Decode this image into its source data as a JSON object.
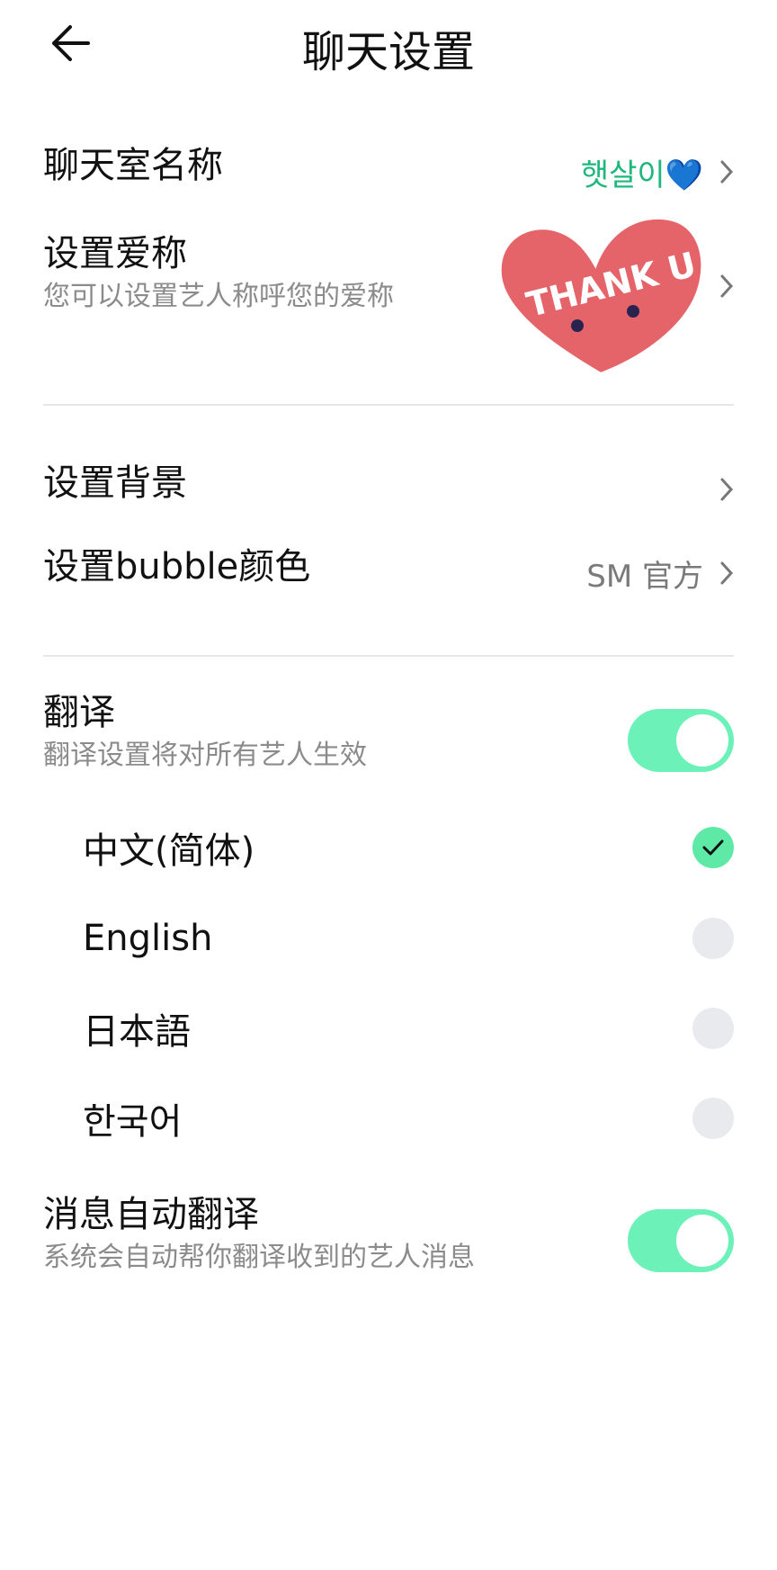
{
  "header": {
    "title": "聊天设置"
  },
  "room_name": {
    "label": "聊天室名称",
    "value": "햇살이💙"
  },
  "nickname": {
    "label": "设置爱称",
    "description": "您可以设置艺人称呼您的爱称",
    "sticker_text": "THANK U"
  },
  "background": {
    "label": "设置背景"
  },
  "bubble": {
    "label": "设置bubble颜色",
    "value": "SM 官方"
  },
  "translation": {
    "label": "翻译",
    "description": "翻译设置将对所有艺人生效",
    "enabled": true,
    "languages": [
      {
        "name": "中文(简体)",
        "selected": true
      },
      {
        "name": "English",
        "selected": false
      },
      {
        "name": "日本語",
        "selected": false
      },
      {
        "name": "한국어",
        "selected": false
      }
    ]
  },
  "auto_translate": {
    "label": "消息自动翻译",
    "description": "系统会自动帮你翻译收到的艺人消息",
    "enabled": true
  },
  "colors": {
    "accent_green": "#6cf1b8",
    "value_green": "#1fb77e",
    "heart_red": "#e5646a"
  }
}
